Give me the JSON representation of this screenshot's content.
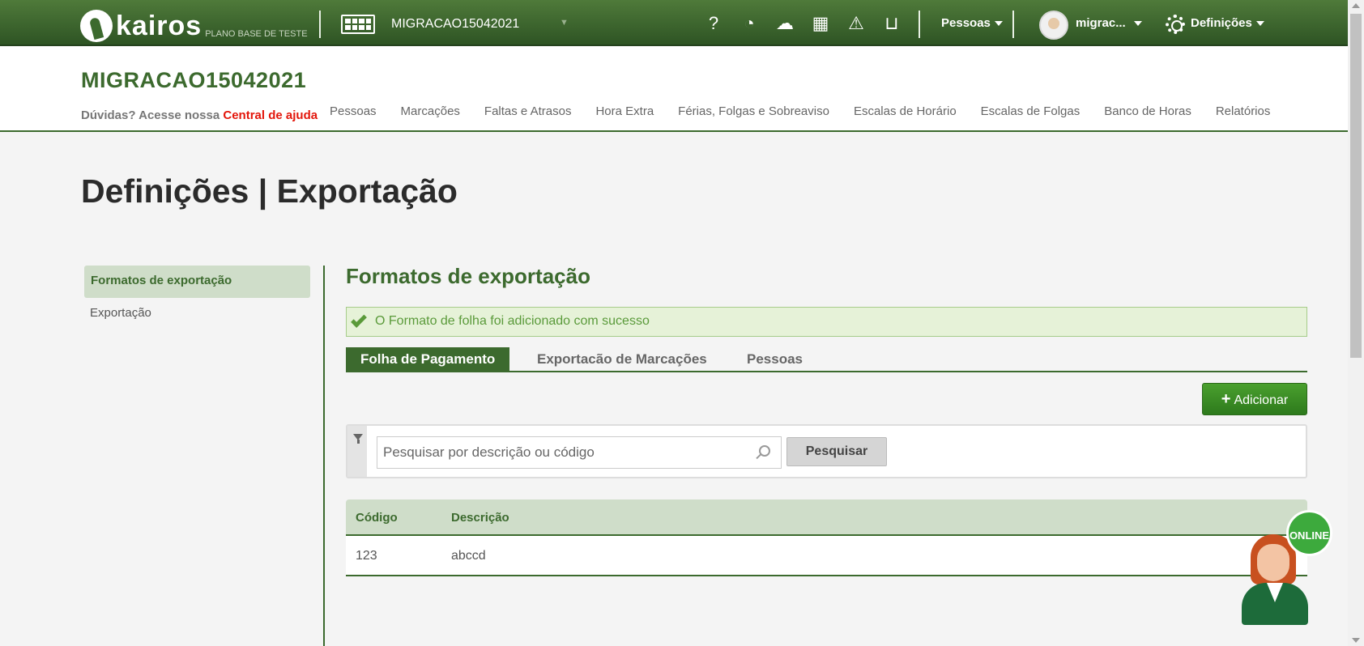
{
  "topbar": {
    "logo_text": "kairos",
    "logo_subtitle": "PLANO BASE DE TESTE",
    "company_name": "MIGRACAO15042021",
    "icons": [
      "help-icon",
      "clock-check-icon",
      "cloud-download-icon",
      "calculator-icon",
      "warning-icon",
      "inbox-icon"
    ],
    "pessoas_menu": "Pessoas",
    "user_name": "migrac...",
    "settings_menu": "Definições"
  },
  "header": {
    "company_title": "MIGRACAO15042021",
    "help_prefix": "Dúvidas? Acesse nossa",
    "help_link": "Central de ajuda",
    "nav": [
      "Pessoas",
      "Marcações",
      "Faltas e Atrasos",
      "Hora Extra",
      "Férias, Folgas e Sobreaviso",
      "Escalas de Horário",
      "Escalas de Folgas",
      "Banco de Horas",
      "Relatórios"
    ]
  },
  "page": {
    "title": "Definições | Exportação"
  },
  "sidebar": {
    "items": [
      "Formatos de exportação",
      "Exportação"
    ],
    "active": "Formatos de exportação"
  },
  "content": {
    "title": "Formatos de exportação",
    "alert": "O Formato de folha foi adicionado com sucesso",
    "tabs": [
      "Folha de Pagamento",
      "Exportacão de Marcações",
      "Pessoas"
    ],
    "active_tab": "Folha de Pagamento",
    "add_button": "Adicionar",
    "search": {
      "placeholder": "Pesquisar por descrição ou código",
      "value": "",
      "button": "Pesquisar"
    },
    "table": {
      "headers": [
        "Código",
        "Descrição"
      ],
      "rows": [
        [
          "123",
          "abccd"
        ]
      ]
    }
  },
  "chat": {
    "status": "ONLINE"
  },
  "colors": {
    "brand_green": "#3c6a2e",
    "topbar": "#3a6330",
    "alert_bg": "#e6f2d8",
    "link_red": "#e3160b",
    "add_button": "#3a8e25"
  }
}
